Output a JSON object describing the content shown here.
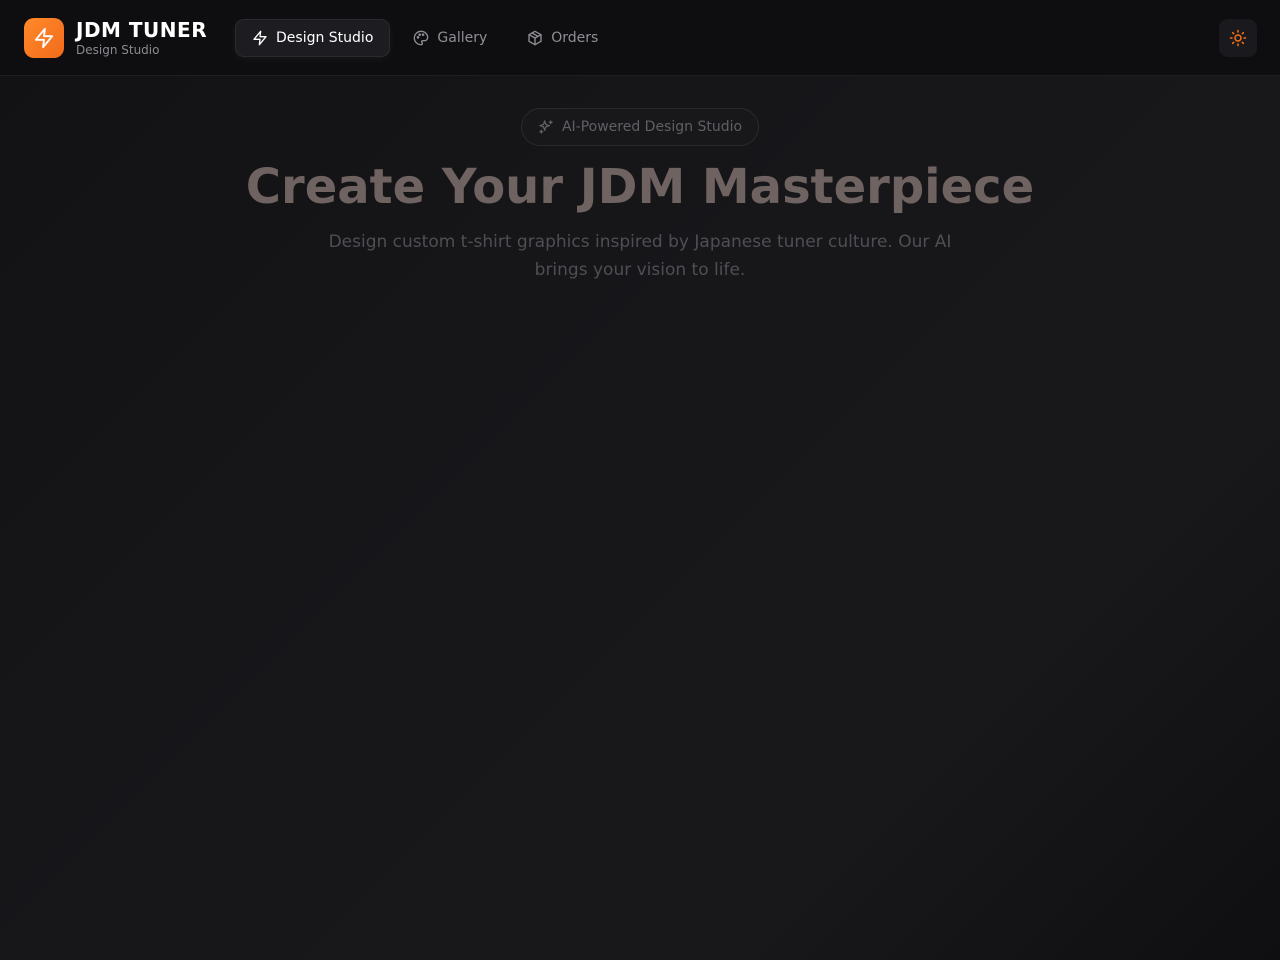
{
  "brand": {
    "title": "JDM TUNER",
    "subtitle": "Design Studio",
    "logo_icon": "lightning-icon",
    "accent_color": "#f97316"
  },
  "nav": {
    "items": [
      {
        "label": "Design Studio",
        "icon": "lightning-icon",
        "active": true
      },
      {
        "label": "Gallery",
        "icon": "palette-icon",
        "active": false
      },
      {
        "label": "Orders",
        "icon": "package-icon",
        "active": false
      }
    ]
  },
  "theme_toggle": {
    "icon": "sun-icon"
  },
  "hero": {
    "badge": "AI-Powered Design Studio",
    "badge_icon": "sparkles-icon",
    "title": "Create Your JDM Masterpiece",
    "description": "Design custom t-shirt graphics inspired by Japanese tuner culture. Our AI brings your vision to life."
  }
}
